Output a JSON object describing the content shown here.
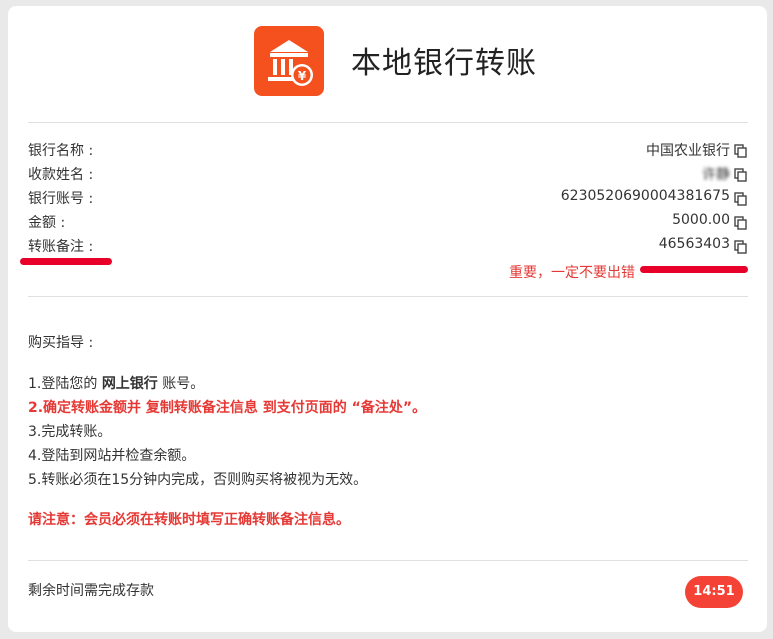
{
  "header": {
    "title": "本地银行转账",
    "logo_icon": "bank-transfer-icon",
    "accent": "#f4511e"
  },
  "details": [
    {
      "label": "银行名称 :",
      "value": "中国农业银行",
      "copy_icon": "copy-icon"
    },
    {
      "label": "收款姓名 :",
      "value": "许静",
      "copy_icon": "copy-icon"
    },
    {
      "label": "银行账号 :",
      "value": "6230520690004381675",
      "copy_icon": "copy-icon"
    },
    {
      "label": "金额 :",
      "value": "5000.00",
      "copy_icon": "copy-icon"
    },
    {
      "label": "转账备注 :",
      "value": "46563403",
      "copy_icon": "copy-icon"
    }
  ],
  "annotation": {
    "text": "重要，一定不要出错",
    "color": "#e53935"
  },
  "guide": {
    "title": "购买指导 :",
    "step1_prefix": "1.登陆您的 ",
    "step1_bold": "网上银行",
    "step1_suffix": " 账号。",
    "step2": "2.确定转账金额并 复制转账备注信息 到支付页面的 “备注处”。",
    "step3": "3.完成转账。",
    "step4": "4.登陆到网站并检查余额。",
    "step5": "5.转账必须在15分钟内完成，否则购买将被视为无效。",
    "notice": "请注意：会员必须在转账时填写正确转账备注信息。"
  },
  "footer": {
    "label": "剩余时间需完成存款",
    "countdown": "14:51",
    "countdown_color": "#f44336"
  }
}
